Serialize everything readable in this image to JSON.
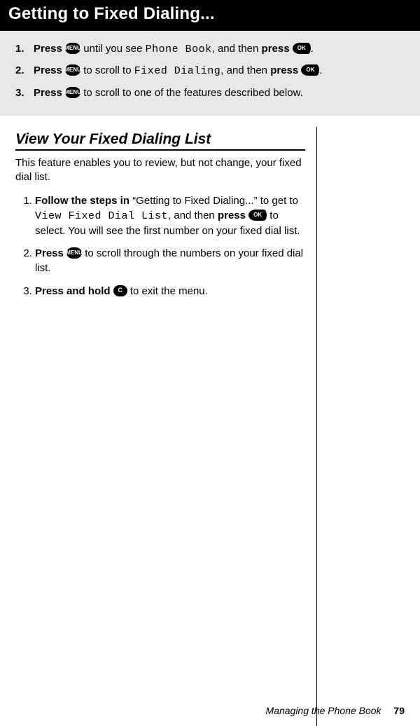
{
  "header": {
    "title": "Getting to Fixed Dialing..."
  },
  "icons": {
    "menu": "MENU",
    "ok": "OK",
    "c": "C"
  },
  "graybox": {
    "items": [
      {
        "num": "1.",
        "pre": "Press ",
        "icon1": "menu",
        "mid": " until you see ",
        "lcd": "Phone Book",
        "post1": ", and then ",
        "bold2": "press ",
        "icon2": "ok",
        "post2": "."
      },
      {
        "num": "2.",
        "pre": "Press ",
        "icon1": "menu",
        "mid": " to scroll to ",
        "lcd": "Fixed Dialing",
        "post1": ", and then ",
        "bold2": "press ",
        "icon2": "ok",
        "post2": "."
      },
      {
        "num": "3.",
        "pre": "Press ",
        "icon1": "menu",
        "mid": " to scroll to one of the features described below.",
        "lcd": "",
        "post1": "",
        "bold2": "",
        "icon2": "",
        "post2": ""
      }
    ]
  },
  "section": {
    "title": "View Your Fixed Dialing List",
    "intro": "This feature enables you to review, but not change, your fixed dial list.",
    "steps": [
      {
        "num": "1.",
        "bold1": "Follow the steps in ",
        "text1": "“Getting to Fixed Dialing...” to get to ",
        "lcd": "View Fixed Dial List",
        "text2": ", and then ",
        "bold2": "press ",
        "icon": "ok",
        "text3": " to select. You will see the first number on your fixed dial list."
      },
      {
        "num": "2.",
        "bold1": "Press ",
        "text1": "",
        "lcd": "",
        "text2": "",
        "bold2": "",
        "icon": "menu",
        "text3": " to scroll through the numbers on your fixed dial list."
      },
      {
        "num": "3.",
        "bold1": "Press and hold ",
        "text1": "",
        "lcd": "",
        "text2": "",
        "bold2": "",
        "icon": "c",
        "text3": " to exit the menu."
      }
    ]
  },
  "footer": {
    "chapter": "Managing the Phone Book",
    "page": "79"
  }
}
